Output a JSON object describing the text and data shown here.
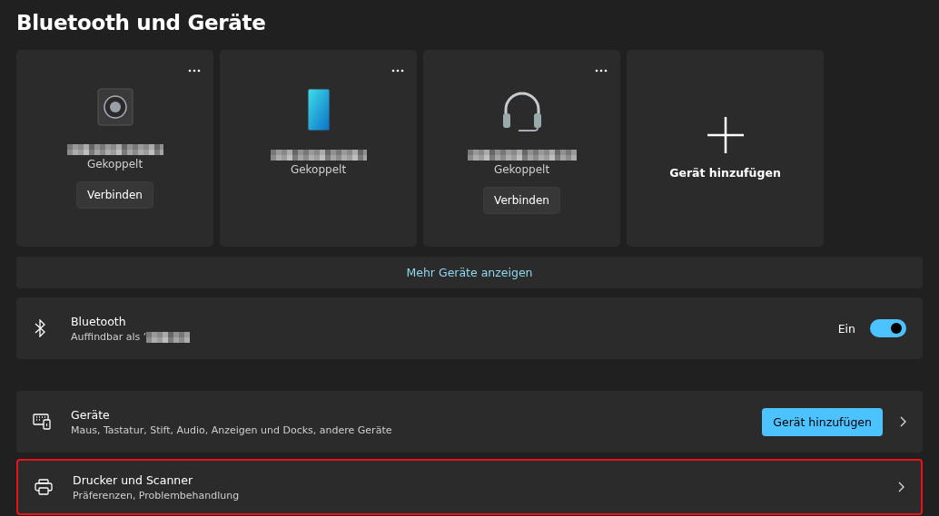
{
  "page": {
    "title": "Bluetooth und Geräte"
  },
  "devices": [
    {
      "kind": "device",
      "status": "Gekoppelt",
      "button": "Verbinden"
    },
    {
      "kind": "device",
      "status": "Gekoppelt"
    },
    {
      "kind": "device",
      "status": "Gekoppelt",
      "button": "Verbinden"
    },
    {
      "kind": "add",
      "label": "Gerät hinzufügen"
    }
  ],
  "more_link": "Mehr Geräte anzeigen",
  "bluetooth": {
    "title": "Bluetooth",
    "subtitle": "Auffindbar als ‘",
    "toggle_label": "Ein",
    "on": true
  },
  "settings": [
    {
      "title": "Geräte",
      "subtitle": "Maus, Tastatur, Stift, Audio, Anzeigen und Docks, andere Geräte",
      "button": "Gerät hinzufügen",
      "highlighted": false
    },
    {
      "title": "Drucker und Scanner",
      "subtitle": "Präferenzen, Problembehandlung",
      "highlighted": true
    }
  ]
}
